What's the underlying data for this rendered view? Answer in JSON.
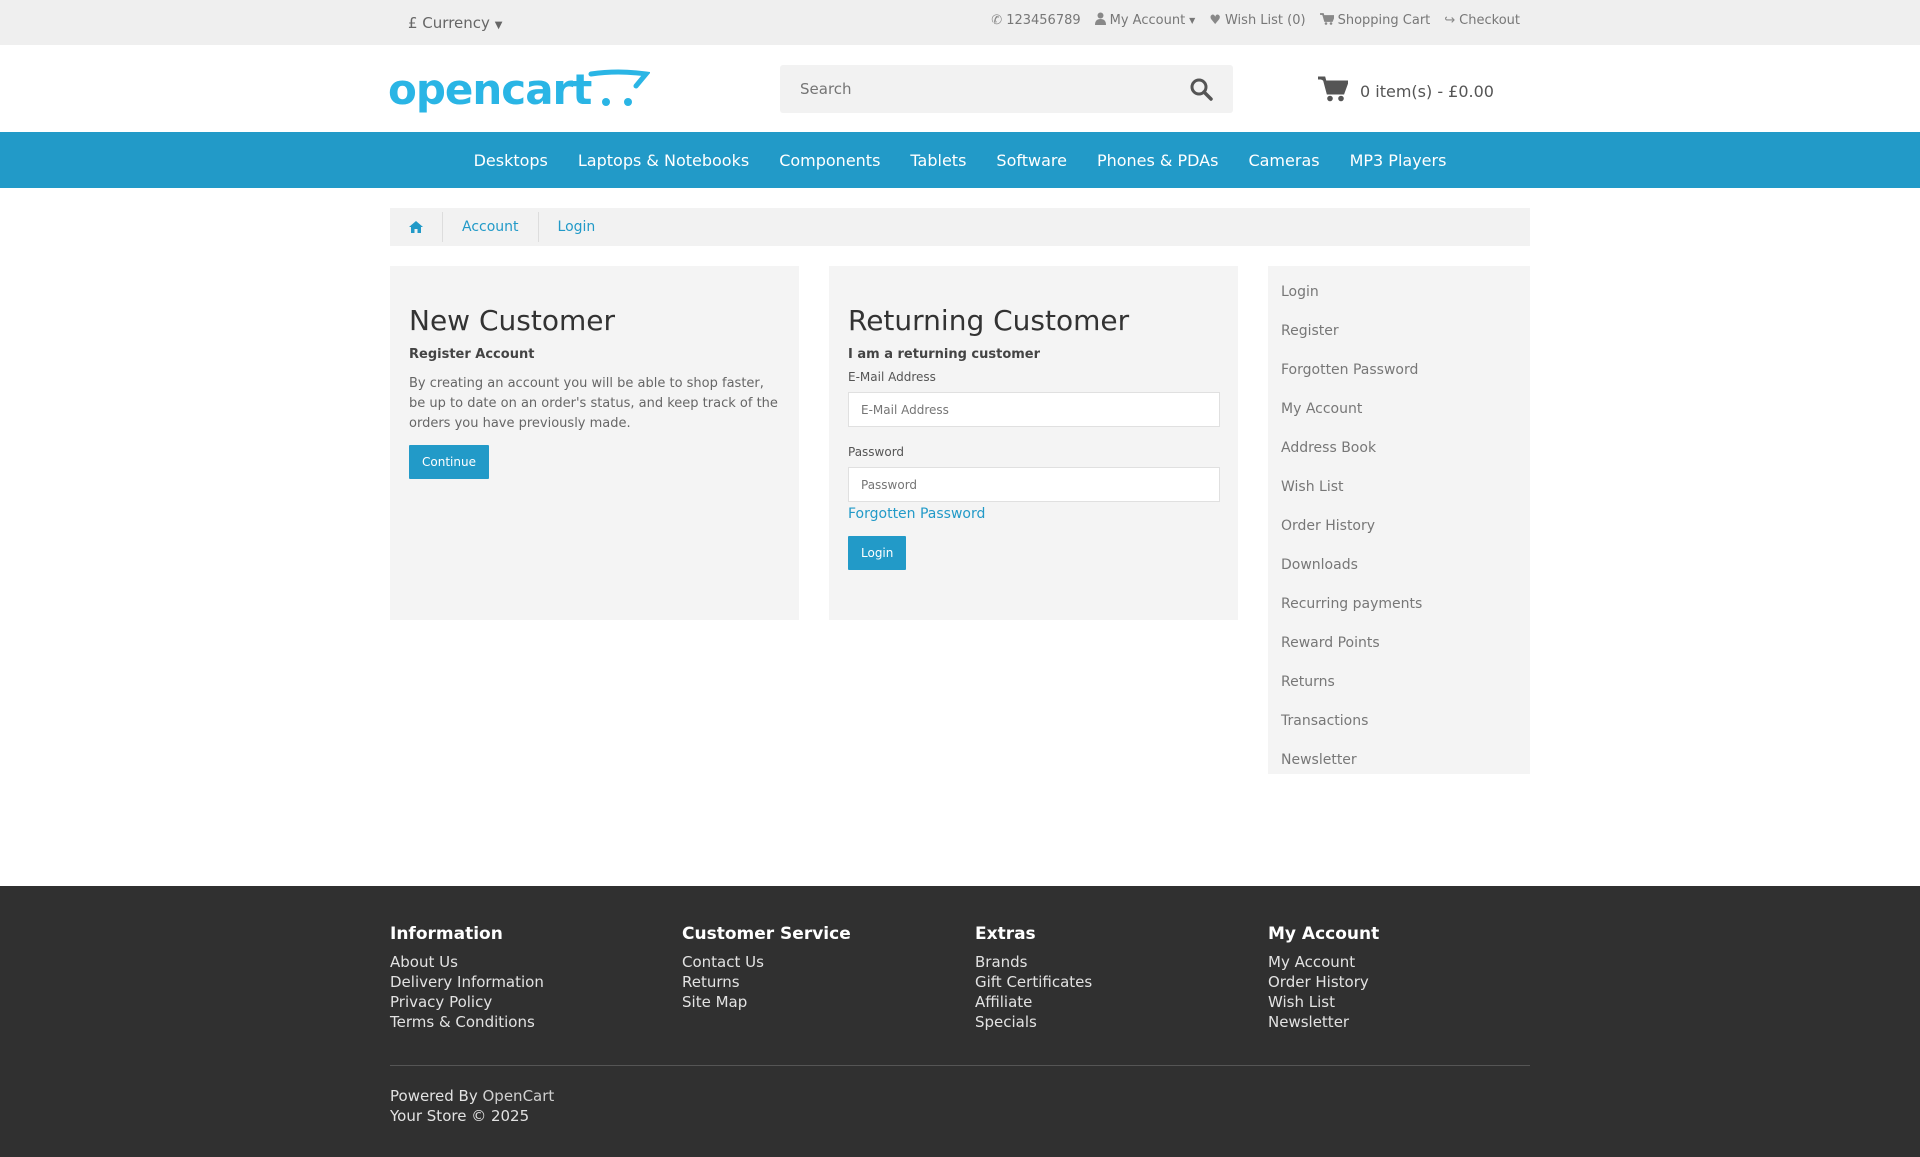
{
  "topbar": {
    "currency": "£ Currency",
    "phone": "123456789",
    "my_account": "My Account",
    "wish_list": "Wish List (0)",
    "shopping_cart": "Shopping Cart",
    "checkout": "Checkout"
  },
  "header": {
    "logo_text": "opencart",
    "search_placeholder": "Search",
    "cart_text": "0 item(s) - £0.00"
  },
  "menu": [
    "Desktops",
    "Laptops & Notebooks",
    "Components",
    "Tablets",
    "Software",
    "Phones & PDAs",
    "Cameras",
    "MP3 Players"
  ],
  "breadcrumb": [
    "Account",
    "Login"
  ],
  "new_customer": {
    "title": "New Customer",
    "subtitle": "Register Account",
    "text": "By creating an account you will be able to shop faster, be up to date on an order's status, and keep track of the orders you have previously made.",
    "button": "Continue"
  },
  "returning_customer": {
    "title": "Returning Customer",
    "subtitle": "I am a returning customer",
    "email_label": "E-Mail Address",
    "email_placeholder": "E-Mail Address",
    "password_label": "Password",
    "password_placeholder": "Password",
    "forgotten": "Forgotten Password",
    "button": "Login"
  },
  "account_list": [
    "Login",
    "Register",
    "Forgotten Password",
    "My Account",
    "Address Book",
    "Wish List",
    "Order History",
    "Downloads",
    "Recurring payments",
    "Reward Points",
    "Returns",
    "Transactions",
    "Newsletter"
  ],
  "footer": {
    "columns": [
      {
        "title": "Information",
        "links": [
          "About Us",
          "Delivery Information",
          "Privacy Policy",
          "Terms & Conditions"
        ]
      },
      {
        "title": "Customer Service",
        "links": [
          "Contact Us",
          "Returns",
          "Site Map"
        ]
      },
      {
        "title": "Extras",
        "links": [
          "Brands",
          "Gift Certificates",
          "Affiliate",
          "Specials"
        ]
      },
      {
        "title": "My Account",
        "links": [
          "My Account",
          "Order History",
          "Wish List",
          "Newsletter"
        ]
      }
    ],
    "powered_by": "Powered By",
    "powered_link": "OpenCart",
    "copyright": "Your Store © 2025"
  },
  "colors": {
    "accent": "#229ac8",
    "footer_bg": "#303030",
    "panel_bg": "#f4f4f4"
  }
}
